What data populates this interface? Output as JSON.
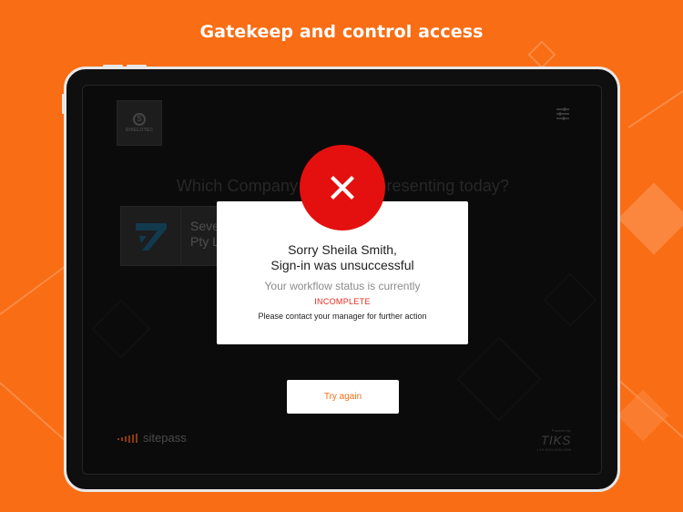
{
  "headline": "Gatekeep and control access",
  "screen": {
    "company_logo_text": "SHIELOTEC",
    "company_logo_mark": "S",
    "question": "Which Company are you representing today?",
    "company_card": {
      "name": "Seve\nPty L"
    },
    "try_again_label": "Try again",
    "sitepass_text": "sitepass",
    "powered": {
      "label": "Powered by",
      "brand": "TIKS",
      "version": "1.19.1024.1294.1296"
    }
  },
  "dialog": {
    "title_line1": "Sorry Sheila Smith,",
    "title_line2": "Sign-in was unsuccessful",
    "status_text": "Your workflow status is currently",
    "status_value": "INCOMPLETE",
    "contact_text": "Please contact your manager for further action"
  },
  "icons": {
    "error": "close-icon",
    "filter": "filter-icon",
    "company_card_logo": "swift-logo-icon"
  },
  "colors": {
    "background": "#f96d14",
    "error_red": "#e3100f",
    "status_red": "#e52b1e",
    "device_bezel": "#0f0f0f",
    "button_text": "#f96d14"
  }
}
